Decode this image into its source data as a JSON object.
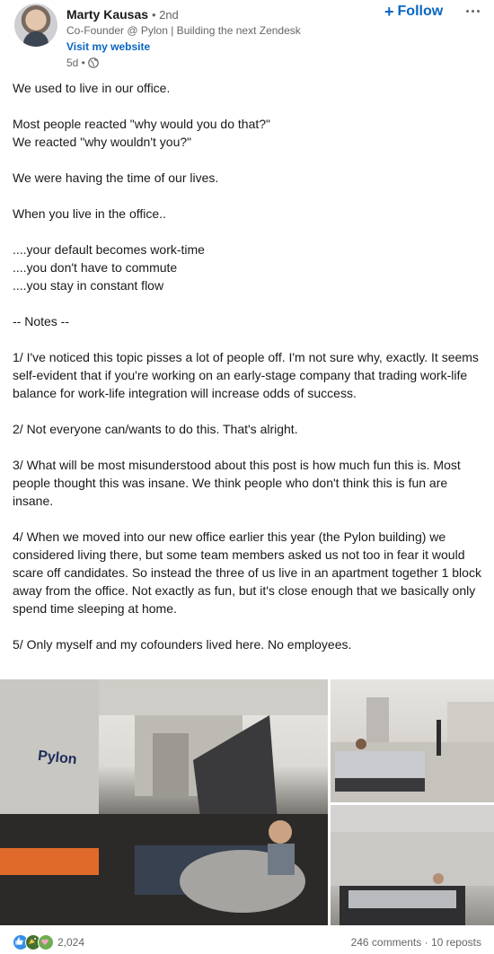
{
  "author": {
    "name": "Marty Kausas",
    "degree": "• 2nd",
    "headline": "Co-Founder @ Pylon | Building the next Zendesk",
    "website_label": "Visit my website",
    "age": "5d •",
    "visibility_icon": "globe-icon"
  },
  "actions": {
    "follow_label": "Follow",
    "follow_icon": "plus-icon",
    "more_icon": "ellipsis-icon"
  },
  "post": {
    "paragraphs": [
      "We used to live in our office.",
      "Most people reacted \"why would you do that?\"\nWe reacted \"why wouldn't you?\"",
      "We were having the time of our lives.",
      "When you live in the office..",
      "....your default becomes work-time\n....you don't have to commute\n....you stay in constant flow",
      "",
      "-- Notes --",
      "1/ I've noticed this topic pisses a lot of people off. I'm not sure why, exactly. It seems self-evident that if you're working on an early-stage company that trading work-life balance for work-life integration will increase odds of success.",
      "2/ Not everyone can/wants to do this. That's alright.",
      "3/ What will be most misunderstood about this post is how much fun this is. Most people thought this was insane. We think people who don't think this is fun are insane.",
      "4/ When we moved into our new office earlier this year (the Pylon building) we considered living there, but some team members asked us not too in fear it would scare off candidates. So instead the three of us live in an apartment together 1 block away from the office. Not exactly as fun, but it's close enough that we basically only spend time sleeping at home.",
      "5/ Only myself and my cofounders lived here. No employees."
    ],
    "image_sign_text": "Pylon"
  },
  "footer": {
    "reaction_icons": [
      "like-icon",
      "celebrate-icon",
      "support-icon"
    ],
    "reaction_count": "2,024",
    "comments": "246 comments",
    "separator": "·",
    "reposts": "10 reposts"
  }
}
